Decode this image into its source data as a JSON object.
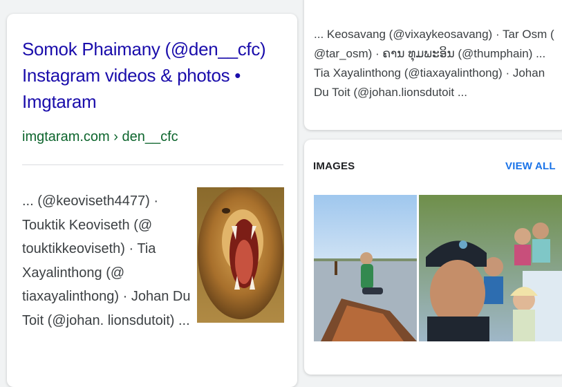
{
  "left_result": {
    "title": "Somok Phaimany (@den__cfc) Instagram videos & photos • Imgtaram",
    "url": "imgtaram.com › den__cfc",
    "snippet": "... (@keoviseth4477) · Touktik Keoviseth (@ touktikkeoviseth) · Tia Xayalinthong (@ tiaxayalinthong) · Johan Du Toit (@johan. lionsdutoit) ...",
    "thumbnail_icon": "lion-roaring-image"
  },
  "right_result": {
    "snippet": "... Keosavang (@vixaykeosavang) · Tar Osm ( @tar_osm) · ຄານ ທຸມພະອິນ (@thumphain) ... Tia Xayalinthong (@tiaxayalinthong) · Johan Du Toit (@johan.lionsdutoit ..."
  },
  "images_section": {
    "header": "IMAGES",
    "view_all": "VIEW ALL",
    "images": [
      {
        "icon": "man-in-boat-image"
      },
      {
        "icon": "group-selfie-image"
      }
    ]
  },
  "colors": {
    "link_title": "#1a0dab",
    "url_green": "#0d652d",
    "accent_blue": "#1a73e8",
    "snippet_text": "#3c4043"
  }
}
